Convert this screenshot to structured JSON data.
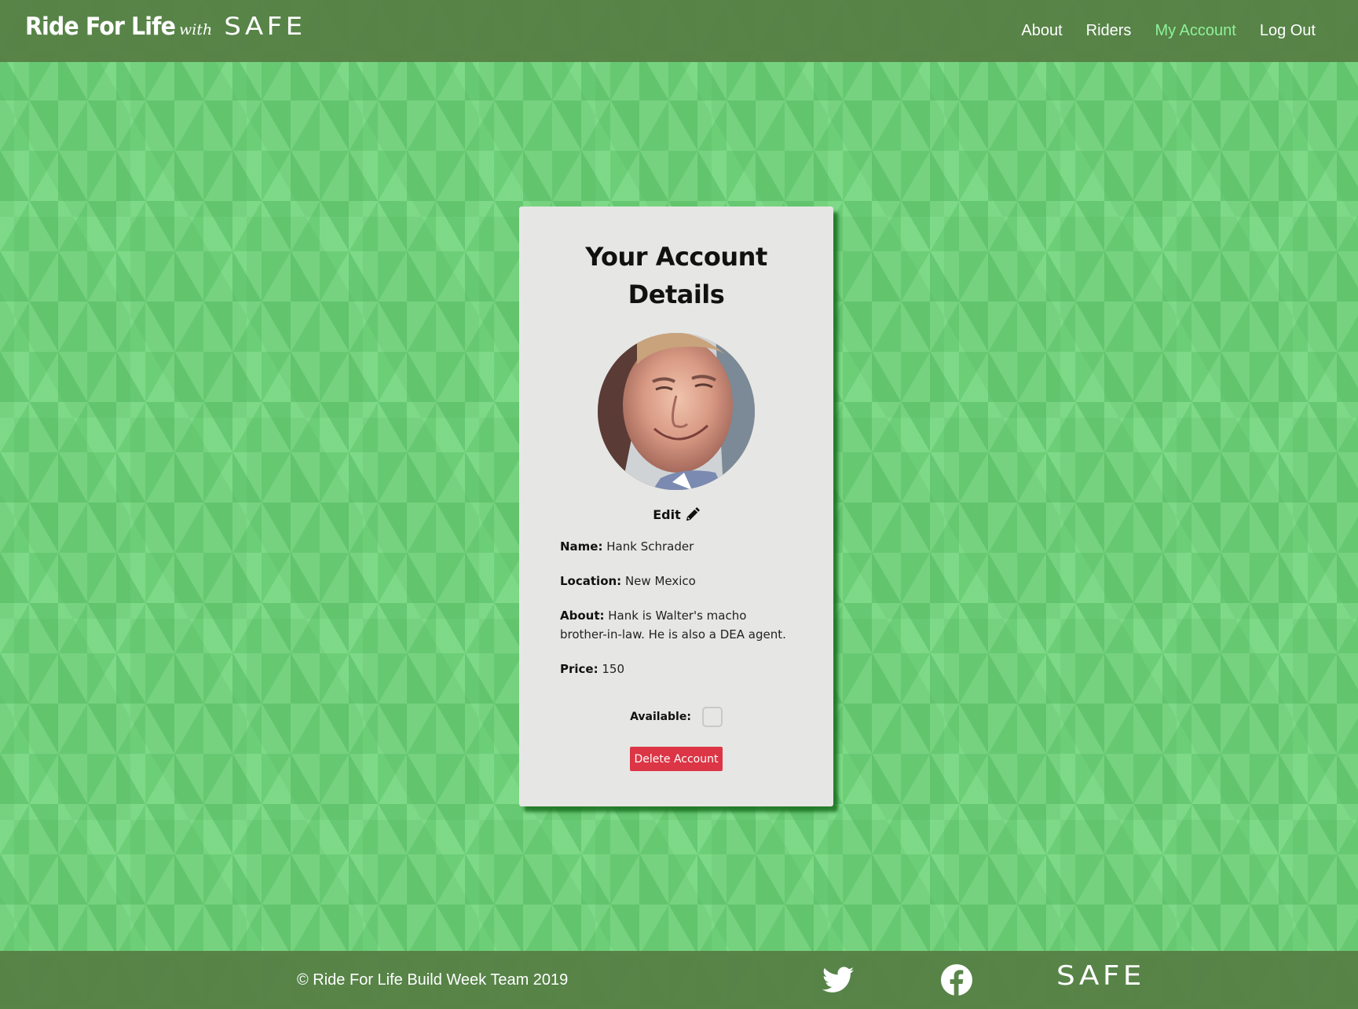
{
  "header": {
    "brand_main": "Ride For Life",
    "brand_with": "with",
    "brand_safe": "SAFE",
    "nav": [
      {
        "label": "About",
        "active": false
      },
      {
        "label": "Riders",
        "active": false
      },
      {
        "label": "My Account",
        "active": true
      },
      {
        "label": "Log Out",
        "active": false
      }
    ]
  },
  "card": {
    "title_line1": "Your Account",
    "title_line2": "Details",
    "edit_label": "Edit",
    "fields": {
      "name_label": "Name:",
      "name_value": "Hank Schrader",
      "location_label": "Location:",
      "location_value": "New Mexico",
      "about_label": "About:",
      "about_value": "Hank is Walter's macho brother-in-law. He is also a DEA agent.",
      "price_label": "Price:",
      "price_value": "150"
    },
    "available_label": "Available:",
    "available_checked": false,
    "delete_label": "Delete Account"
  },
  "footer": {
    "copyright": "© Ride For Life Build Week Team 2019",
    "safe": "SAFE",
    "icons": [
      "twitter-icon",
      "facebook-icon"
    ]
  },
  "colors": {
    "header_bg": "#5a8549",
    "page_bg": "#76d27f",
    "nav_active": "#8ef39a",
    "card_bg": "#e6e7e4",
    "delete_bg": "#dc3545"
  }
}
